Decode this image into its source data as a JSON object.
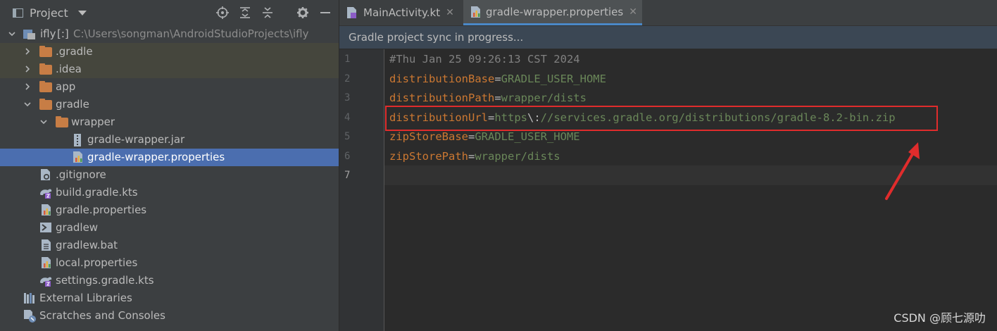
{
  "project_panel": {
    "title": "Project",
    "tree": [
      {
        "label": "ifly",
        "suffix": "[:]",
        "path": "C:\\Users\\songman\\AndroidStudioProjects\\ifly",
        "depth": 0,
        "icon": "module-icon",
        "expanded": true
      },
      {
        "label": ".gradle",
        "depth": 1,
        "icon": "folder-icon",
        "expanded": false
      },
      {
        "label": ".idea",
        "depth": 1,
        "icon": "folder-icon",
        "expanded": false
      },
      {
        "label": "app",
        "depth": 1,
        "icon": "folder-icon",
        "expanded": false
      },
      {
        "label": "gradle",
        "depth": 1,
        "icon": "folder-icon",
        "expanded": true
      },
      {
        "label": "wrapper",
        "depth": 2,
        "icon": "folder-icon",
        "expanded": true
      },
      {
        "label": "gradle-wrapper.jar",
        "depth": 3,
        "icon": "jar-icon"
      },
      {
        "label": "gradle-wrapper.properties",
        "depth": 3,
        "icon": "properties-icon",
        "selected": true
      },
      {
        "label": ".gitignore",
        "depth": 1,
        "icon": "gitignore-icon"
      },
      {
        "label": "build.gradle.kts",
        "depth": 1,
        "icon": "gradle-kts-icon"
      },
      {
        "label": "gradle.properties",
        "depth": 1,
        "icon": "properties-icon"
      },
      {
        "label": "gradlew",
        "depth": 1,
        "icon": "shell-icon"
      },
      {
        "label": "gradlew.bat",
        "depth": 1,
        "icon": "text-file-icon"
      },
      {
        "label": "local.properties",
        "depth": 1,
        "icon": "properties-icon"
      },
      {
        "label": "settings.gradle.kts",
        "depth": 1,
        "icon": "gradle-kts-icon"
      },
      {
        "label": "External Libraries",
        "depth": 0,
        "icon": "libraries-icon"
      },
      {
        "label": "Scratches and Consoles",
        "depth": 0,
        "icon": "scratches-icon"
      }
    ]
  },
  "editor": {
    "tabs": [
      {
        "label": "MainActivity.kt",
        "active": false
      },
      {
        "label": "gradle-wrapper.properties",
        "active": true
      }
    ],
    "banner": "Gradle project sync in progress...",
    "line_numbers": [
      "1",
      "2",
      "3",
      "4",
      "5",
      "6",
      "7"
    ],
    "lines": [
      {
        "comment": "#Thu Jan 25 09:26:13 CST 2024"
      },
      {
        "key": "distributionBase",
        "eq": "=",
        "value": "GRADLE_USER_HOME"
      },
      {
        "key": "distributionPath",
        "eq": "=",
        "value": "wrapper/dists"
      },
      {
        "key": "distributionUrl",
        "eq": "=",
        "value": "https",
        "escape": "\\:",
        "value2": "//services.gradle.org/distributions/gradle-8.2-bin.zip"
      },
      {
        "key": "zipStoreBase",
        "eq": "=",
        "value": "GRADLE_USER_HOME"
      },
      {
        "key": "zipStorePath",
        "eq": "=",
        "value": "wrapper/dists"
      }
    ]
  },
  "watermark": "CSDN @顾七源叻",
  "colors": {
    "highlight_box": "#e02c2c",
    "arrow": "#e02c2c",
    "selection": "#4b6eaf"
  }
}
